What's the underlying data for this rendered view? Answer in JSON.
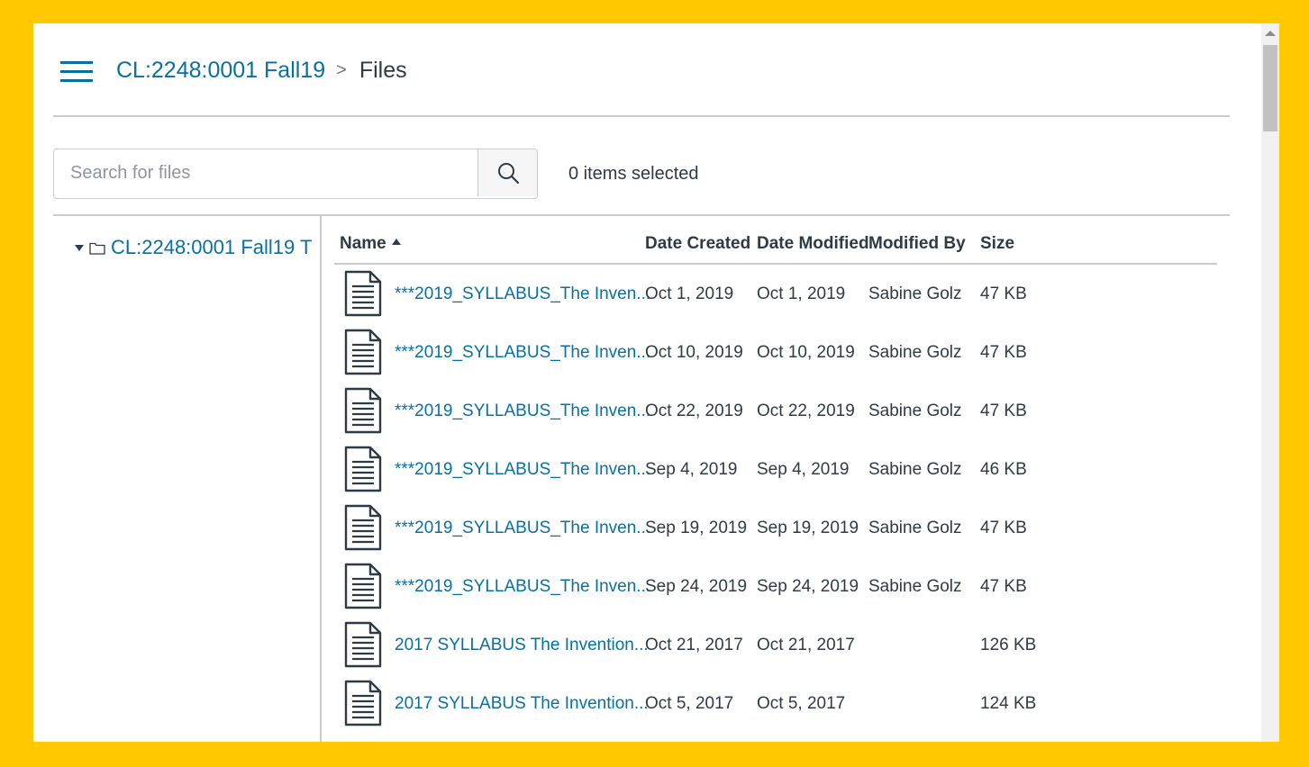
{
  "header": {
    "course": "CL:2248:0001 Fall19",
    "separator": ">",
    "current": "Files"
  },
  "search": {
    "placeholder": "Search for files",
    "value": ""
  },
  "selection": {
    "text": "0 items selected"
  },
  "tree": {
    "root_label": "CL:2248:0001 Fall19 T"
  },
  "table": {
    "columns": {
      "name": "Name",
      "date_created": "Date Created",
      "date_modified": "Date Modified",
      "modified_by": "Modified By",
      "size": "Size"
    },
    "rows": [
      {
        "name": "***2019_SYLLABUS_The Inven...",
        "date_created": "Oct 1, 2019",
        "date_modified": "Oct 1, 2019",
        "modified_by": "Sabine Golz",
        "size": "47 KB"
      },
      {
        "name": "***2019_SYLLABUS_The Inven...",
        "date_created": "Oct 10, 2019",
        "date_modified": "Oct 10, 2019",
        "modified_by": "Sabine Golz",
        "size": "47 KB"
      },
      {
        "name": "***2019_SYLLABUS_The Inven...",
        "date_created": "Oct 22, 2019",
        "date_modified": "Oct 22, 2019",
        "modified_by": "Sabine Golz",
        "size": "47 KB"
      },
      {
        "name": "***2019_SYLLABUS_The Inven...",
        "date_created": "Sep 4, 2019",
        "date_modified": "Sep 4, 2019",
        "modified_by": "Sabine Golz",
        "size": "46 KB"
      },
      {
        "name": "***2019_SYLLABUS_The Inven...",
        "date_created": "Sep 19, 2019",
        "date_modified": "Sep 19, 2019",
        "modified_by": "Sabine Golz",
        "size": "47 KB"
      },
      {
        "name": "***2019_SYLLABUS_The Inven...",
        "date_created": "Sep 24, 2019",
        "date_modified": "Sep 24, 2019",
        "modified_by": "Sabine Golz",
        "size": "47 KB"
      },
      {
        "name": "2017 SYLLABUS The Invention...",
        "date_created": "Oct 21, 2017",
        "date_modified": "Oct 21, 2017",
        "modified_by": "",
        "size": "126 KB"
      },
      {
        "name": "2017 SYLLABUS The Invention...",
        "date_created": "Oct 5, 2017",
        "date_modified": "Oct 5, 2017",
        "modified_by": "",
        "size": "124 KB"
      }
    ]
  },
  "icons": {
    "menu": "hamburger-icon",
    "search": "search-icon",
    "folder": "folder-icon",
    "file": "document-icon",
    "caret": "caret-down-icon",
    "sort": "sort-ascending-icon"
  },
  "colors": {
    "frame": "#FFC800",
    "link": "#0770a3",
    "text": "#2d3b45",
    "border": "#c7cdd1"
  }
}
